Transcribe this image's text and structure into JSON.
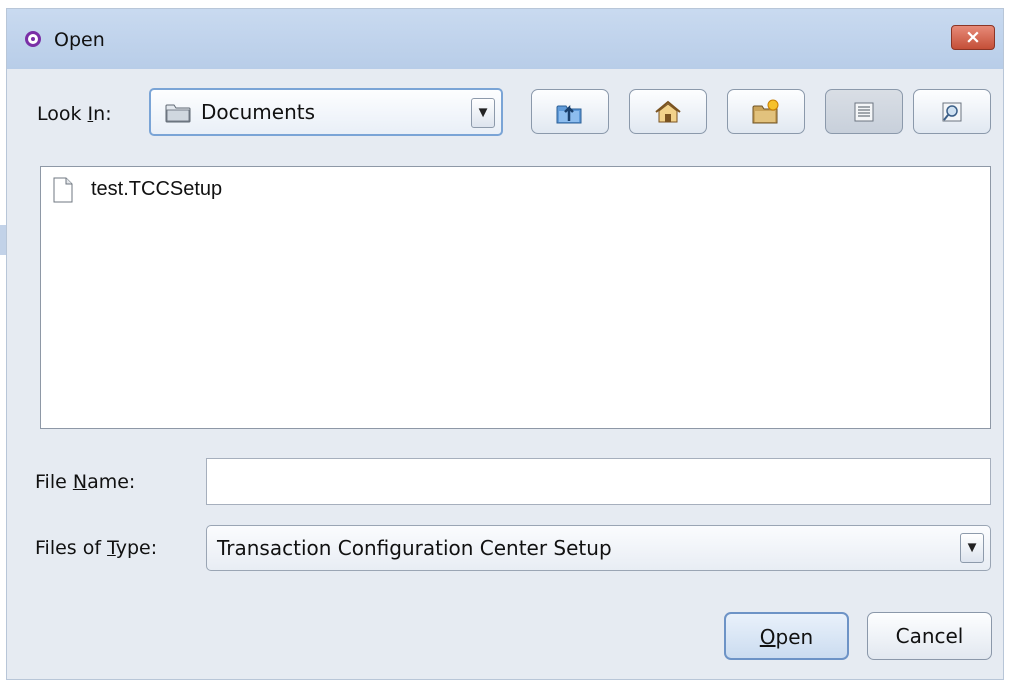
{
  "window": {
    "title": "Open",
    "close_symbol": "×",
    "icon": "app-ring-icon"
  },
  "look_in": {
    "label_prefix": "Look ",
    "label_mnemonic": "I",
    "label_suffix": "n:",
    "value": "Documents",
    "arrow": "▼",
    "icon": "folder-icon"
  },
  "toolbar": {
    "buttons": [
      {
        "name": "up-one-level-button",
        "icon": "folder-up-icon"
      },
      {
        "name": "home-button",
        "icon": "home-icon"
      },
      {
        "name": "create-new-folder-button",
        "icon": "new-folder-icon"
      },
      {
        "name": "list-view-button",
        "icon": "list-view-icon",
        "active": true
      },
      {
        "name": "details-view-button",
        "icon": "details-view-icon"
      }
    ]
  },
  "files": [
    {
      "name": "test.TCCSetup",
      "icon": "file-icon"
    }
  ],
  "file_name": {
    "label_prefix": "File ",
    "label_mnemonic": "N",
    "label_suffix": "ame:",
    "value": ""
  },
  "file_type": {
    "label_prefix": "Files of ",
    "label_mnemonic": "T",
    "label_suffix": "ype:",
    "value": "Transaction Configuration Center Setup",
    "arrow": "▼"
  },
  "buttons": {
    "open_mnemonic": "O",
    "open_rest": "pen",
    "cancel": "Cancel"
  },
  "colors": {
    "title_bar": "#c9daf0",
    "dialog_bg": "#e6ebf2",
    "close_button": "#c44f38",
    "app_icon": "#7a2fa6",
    "focus_border": "#6d93c6"
  }
}
